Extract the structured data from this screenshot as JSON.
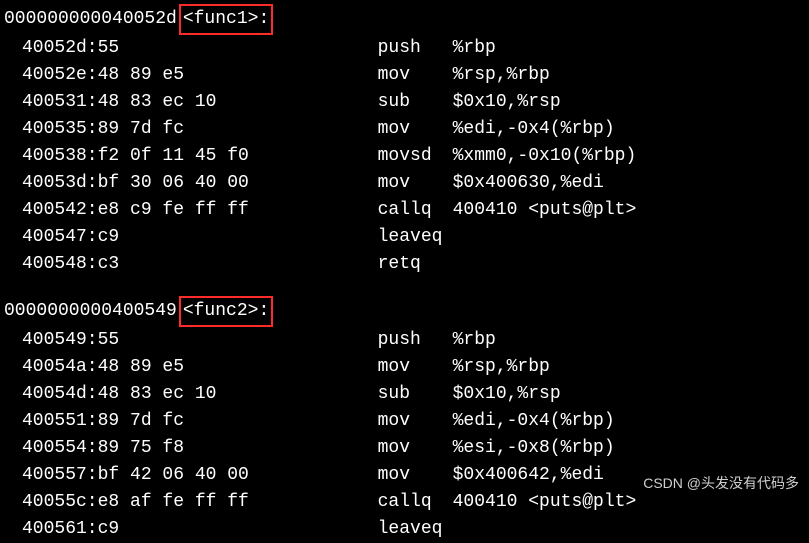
{
  "func1": {
    "header_addr": "000000000040052d",
    "header_label": "<func1>:",
    "lines": [
      {
        "addr": "40052d:",
        "bytes": "55",
        "mnemonic": "push",
        "operands": "%rbp"
      },
      {
        "addr": "40052e:",
        "bytes": "48 89 e5",
        "mnemonic": "mov",
        "operands": "%rsp,%rbp"
      },
      {
        "addr": "400531:",
        "bytes": "48 83 ec 10",
        "mnemonic": "sub",
        "operands": "$0x10,%rsp"
      },
      {
        "addr": "400535:",
        "bytes": "89 7d fc",
        "mnemonic": "mov",
        "operands": "%edi,-0x4(%rbp)"
      },
      {
        "addr": "400538:",
        "bytes": "f2 0f 11 45 f0",
        "mnemonic": "movsd",
        "operands": "%xmm0,-0x10(%rbp)"
      },
      {
        "addr": "40053d:",
        "bytes": "bf 30 06 40 00",
        "mnemonic": "mov",
        "operands": "$0x400630,%edi"
      },
      {
        "addr": "400542:",
        "bytes": "e8 c9 fe ff ff",
        "mnemonic": "callq",
        "operands": "400410 <puts@plt>"
      },
      {
        "addr": "400547:",
        "bytes": "c9",
        "mnemonic": "leaveq",
        "operands": ""
      },
      {
        "addr": "400548:",
        "bytes": "c3",
        "mnemonic": "retq",
        "operands": ""
      }
    ]
  },
  "func2": {
    "header_addr": "0000000000400549",
    "header_label": "<func2>:",
    "lines": [
      {
        "addr": "400549:",
        "bytes": "55",
        "mnemonic": "push",
        "operands": "%rbp"
      },
      {
        "addr": "40054a:",
        "bytes": "48 89 e5",
        "mnemonic": "mov",
        "operands": "%rsp,%rbp"
      },
      {
        "addr": "40054d:",
        "bytes": "48 83 ec 10",
        "mnemonic": "sub",
        "operands": "$0x10,%rsp"
      },
      {
        "addr": "400551:",
        "bytes": "89 7d fc",
        "mnemonic": "mov",
        "operands": "%edi,-0x4(%rbp)"
      },
      {
        "addr": "400554:",
        "bytes": "89 75 f8",
        "mnemonic": "mov",
        "operands": "%esi,-0x8(%rbp)"
      },
      {
        "addr": "400557:",
        "bytes": "bf 42 06 40 00",
        "mnemonic": "mov",
        "operands": "$0x400642,%edi"
      },
      {
        "addr": "40055c:",
        "bytes": "e8 af fe ff ff",
        "mnemonic": "callq",
        "operands": "400410 <puts@plt>"
      },
      {
        "addr": "400561:",
        "bytes": "c9",
        "mnemonic": "leaveq",
        "operands": ""
      }
    ]
  },
  "watermark": "CSDN @头发没有代码多"
}
